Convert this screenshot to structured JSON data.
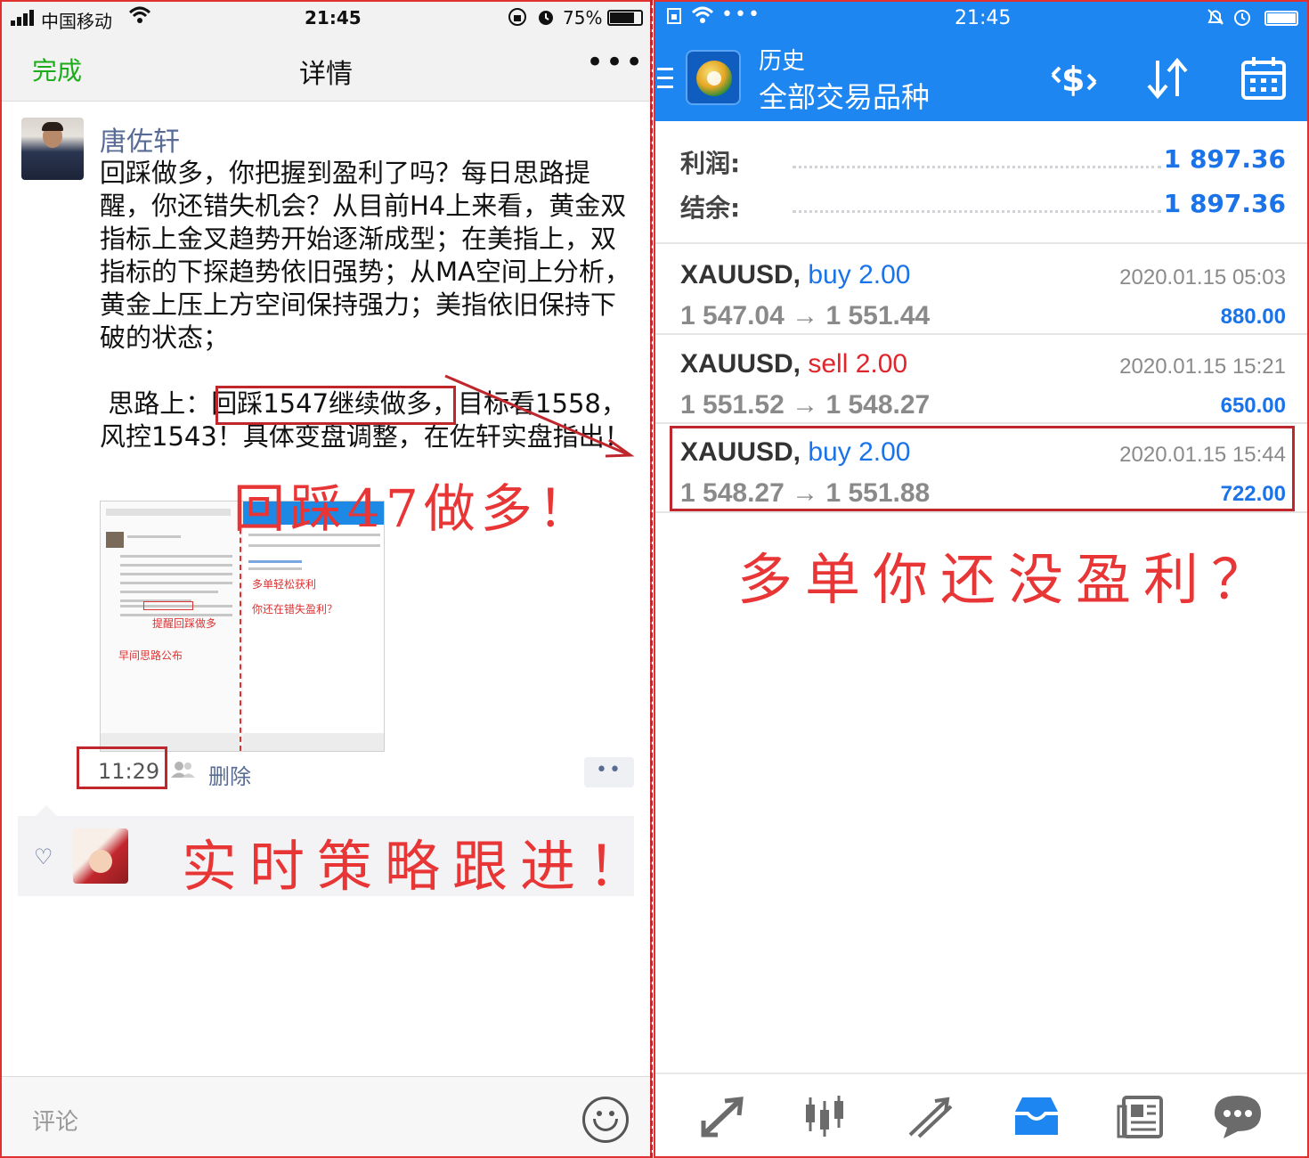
{
  "colors": {
    "annotation_red": "#e83535",
    "wechat_green": "#1aad19",
    "wechat_link": "#576b95",
    "mt4_blue": "#1e86f0",
    "profit_blue": "#1a73e8",
    "sell_red": "#e0262c"
  },
  "wechat": {
    "status": {
      "carrier": "中国移动",
      "time": "21:45",
      "battery": "75%"
    },
    "nav": {
      "done_label": "完成",
      "title": "详情",
      "more_label": "•••"
    },
    "post": {
      "author": "唐佐轩",
      "text_main": "回踩做多，你把握到盈利了吗？每日思路提醒，你还错失机会？从目前H4上来看，黄金双指标上金叉趋势开始逐渐成型；在美指上，双指标的下探趋势依旧强势；从MA空间上分析，黄金上压上方空间保持强力；美指依旧保持下破的状态；",
      "text_idea_prefix": " 思路上：",
      "text_idea_box": "回踩1547继续做多",
      "text_idea_suffix": "，目标看1558，风控1543！具体变盘调整，在佐轩实盘指出！",
      "thumbnail_caption_1": "多单轻松获利",
      "thumbnail_caption_2": "你还在错失盈利？",
      "thumbnail_caption_3": "提醒回踩做多",
      "thumbnail_caption_4": "早间思路公布",
      "time": "11:29",
      "delete_label": "删除",
      "comment_btn": "••"
    },
    "comment_placeholder": "评论",
    "icons": [
      "signal-icon",
      "wifi-icon",
      "lock-rotation-icon",
      "alarm-icon",
      "battery-icon",
      "people-icon",
      "heart-icon",
      "emoji-icon"
    ]
  },
  "mt4": {
    "status": {
      "time": "21:45",
      "dots": "•••"
    },
    "toolbar": {
      "title_small": "历史",
      "title_large": "全部交易品种"
    },
    "summary": [
      {
        "label": "利润:",
        "value": "1 897.36"
      },
      {
        "label": "结余:",
        "value": "1 897.36"
      }
    ],
    "trades": [
      {
        "symbol": "XAUUSD,",
        "direction": "buy",
        "lots": "2.00",
        "open": "1 547.04",
        "close": "1 551.44",
        "date": "2020.01.15 05:03",
        "profit": "880.00"
      },
      {
        "symbol": "XAUUSD,",
        "direction": "sell",
        "lots": "2.00",
        "open": "1 551.52",
        "close": "1 548.27",
        "date": "2020.01.15 15:21",
        "profit": "650.00"
      },
      {
        "symbol": "XAUUSD,",
        "direction": "buy",
        "lots": "2.00",
        "open": "1 548.27",
        "close": "1 551.88",
        "date": "2020.01.15 15:44",
        "profit": "722.00"
      }
    ],
    "arrow_glyph": "→",
    "icons": [
      "menu-icon",
      "mt4-logo",
      "currency-swap-icon",
      "sort-icon",
      "calendar-icon",
      "quotes-tab-icon",
      "chart-tab-icon",
      "trade-tab-icon",
      "history-tab-icon",
      "news-tab-icon",
      "chat-tab-icon"
    ]
  },
  "annotations": {
    "callout_1": "回踩47做多！",
    "callout_2": "多单你还没盈利？",
    "callout_3": "实时策略跟进！"
  }
}
